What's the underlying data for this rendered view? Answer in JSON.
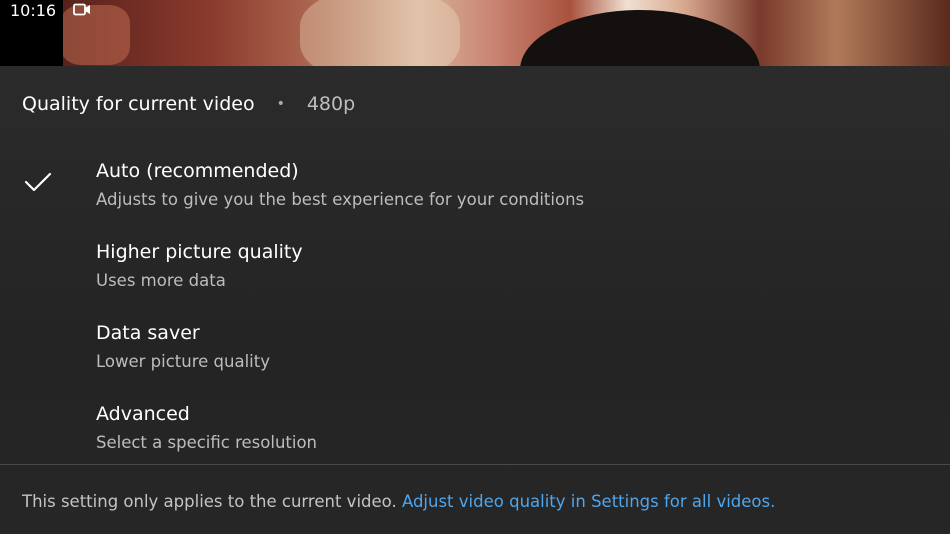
{
  "status_bar": {
    "time": "10:16",
    "camera_icon": "videocam-icon"
  },
  "sheet": {
    "title": "Quality for current video",
    "separator": "•",
    "current_resolution": "480p",
    "options": [
      {
        "title": "Auto (recommended)",
        "subtitle": "Adjusts to give you the best experience for your conditions",
        "selected": true
      },
      {
        "title": "Higher picture quality",
        "subtitle": "Uses more data",
        "selected": false
      },
      {
        "title": "Data saver",
        "subtitle": "Lower picture quality",
        "selected": false
      },
      {
        "title": "Advanced",
        "subtitle": "Select a specific resolution",
        "selected": false
      }
    ],
    "footer_text": "This setting only applies to the current video. ",
    "footer_link": "Adjust video quality in Settings for all videos."
  },
  "colors": {
    "sheet_background": "#2b2b2b",
    "link": "#4ea6ee",
    "secondary_text": "#bdbdbd"
  }
}
